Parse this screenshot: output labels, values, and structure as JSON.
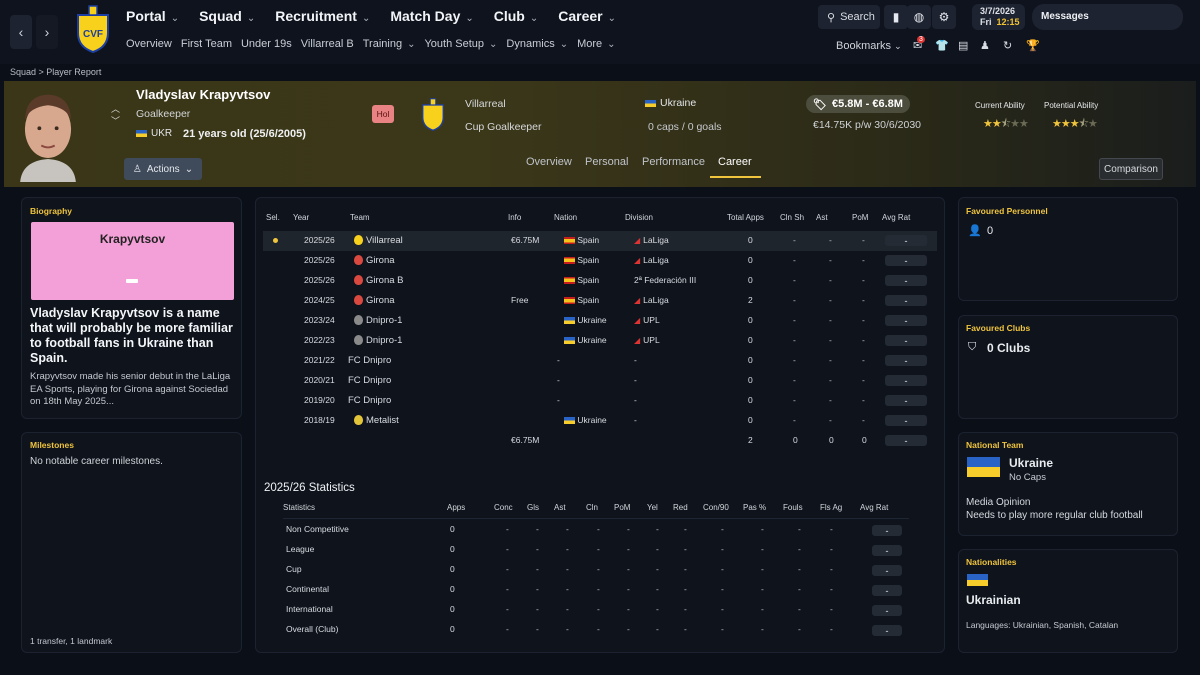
{
  "nav": {
    "main": [
      "Portal",
      "Squad",
      "Recruitment",
      "Match Day",
      "Club",
      "Career"
    ],
    "sub": [
      "Overview",
      "First Team",
      "Under 19s",
      "Villarreal B",
      "Training",
      "Youth Setup",
      "Dynamics",
      "More"
    ],
    "search_label": "Search",
    "date": "3/7/2026",
    "day": "Fri",
    "time": "12:15",
    "messages": "Messages",
    "bookmarks": "Bookmarks",
    "notif_count": "3"
  },
  "breadcrumb": {
    "parent": "Squad",
    "current": "Player Report"
  },
  "player": {
    "name": "Vladyslav Krapyvtsov",
    "position": "Goalkeeper",
    "nation_code": "UKR",
    "age": "21 years old (25/6/2005)",
    "actions": "Actions",
    "hol": "Hol",
    "club": "Villarreal",
    "role": "Cup Goalkeeper",
    "national": "Ukraine",
    "caps": "0 caps / 0 goals",
    "value": "€5.8M - €6.8M",
    "wage": "€14.75K p/w 30/6/2030",
    "current_ability_label": "Current Ability",
    "potential_ability_label": "Potential Ability",
    "current_ability_stars": 2.5,
    "potential_ability_stars": 3.5
  },
  "tabs": [
    "Overview",
    "Personal",
    "Performance",
    "Career"
  ],
  "active_tab": "Career",
  "comparison": "Comparison",
  "biography": {
    "title": "Biography",
    "image_name": "Krapyvtsov",
    "lead": "Vladyslav Krapyvtsov is a name that will probably be more familiar to football fans in Ukraine than Spain.",
    "text": "Krapyvtsov made his senior debut in the LaLiga EA Sports, playing for Girona against Sociedad on 18th May 2025..."
  },
  "milestones": {
    "title": "Milestones",
    "text": "No notable career milestones.",
    "footer": "1 transfer, 1 landmark"
  },
  "career": {
    "headers": [
      "Sel.",
      "Year",
      "Team",
      "Info",
      "Nation",
      "Division",
      "Total Apps",
      "Cln Sh",
      "Ast",
      "PoM",
      "Avg Rat"
    ],
    "rows": [
      {
        "year": "2025/26",
        "team": "Villarreal",
        "info": "€6.75M",
        "nation": "Spain",
        "division": "LaLiga",
        "apps": "0",
        "cln": "-",
        "ast": "-",
        "pom": "-",
        "rat": "-",
        "selected": true
      },
      {
        "year": "2025/26",
        "team": "Girona",
        "info": "",
        "nation": "Spain",
        "division": "LaLiga",
        "apps": "0",
        "cln": "-",
        "ast": "-",
        "pom": "-",
        "rat": "-"
      },
      {
        "year": "2025/26",
        "team": "Girona B",
        "info": "",
        "nation": "Spain",
        "division": "2ª Federación III",
        "apps": "0",
        "cln": "-",
        "ast": "-",
        "pom": "-",
        "rat": "-"
      },
      {
        "year": "2024/25",
        "team": "Girona",
        "info": "Free",
        "nation": "Spain",
        "division": "LaLiga",
        "apps": "2",
        "cln": "-",
        "ast": "-",
        "pom": "-",
        "rat": "-"
      },
      {
        "year": "2023/24",
        "team": "Dnipro-1",
        "info": "",
        "nation": "Ukraine",
        "division": "UPL",
        "apps": "0",
        "cln": "-",
        "ast": "-",
        "pom": "-",
        "rat": "-"
      },
      {
        "year": "2022/23",
        "team": "Dnipro-1",
        "info": "",
        "nation": "Ukraine",
        "division": "UPL",
        "apps": "0",
        "cln": "-",
        "ast": "-",
        "pom": "-",
        "rat": "-"
      },
      {
        "year": "2021/22",
        "team": "FC Dnipro",
        "info": "",
        "nation": "-",
        "division": "-",
        "apps": "0",
        "cln": "-",
        "ast": "-",
        "pom": "-",
        "rat": "-"
      },
      {
        "year": "2020/21",
        "team": "FC Dnipro",
        "info": "",
        "nation": "-",
        "division": "-",
        "apps": "0",
        "cln": "-",
        "ast": "-",
        "pom": "-",
        "rat": "-"
      },
      {
        "year": "2019/20",
        "team": "FC Dnipro",
        "info": "",
        "nation": "-",
        "division": "-",
        "apps": "0",
        "cln": "-",
        "ast": "-",
        "pom": "-",
        "rat": "-"
      },
      {
        "year": "2018/19",
        "team": "Metalist",
        "info": "",
        "nation": "Ukraine",
        "division": "-",
        "apps": "0",
        "cln": "-",
        "ast": "-",
        "pom": "-",
        "rat": "-"
      }
    ],
    "totals": {
      "info": "€6.75M",
      "apps": "2",
      "cln": "0",
      "ast": "0",
      "pom": "0",
      "rat": "-"
    }
  },
  "statistics": {
    "title": "2025/26 Statistics",
    "headers": [
      "Statistics",
      "Apps",
      "Conc",
      "Gls",
      "Ast",
      "Cln",
      "PoM",
      "Yel",
      "Red",
      "Con/90",
      "Pas %",
      "Fouls",
      "Fls Ag",
      "Avg Rat"
    ],
    "rows": [
      {
        "name": "Non Competitive",
        "apps": "0"
      },
      {
        "name": "League",
        "apps": "0"
      },
      {
        "name": "Cup",
        "apps": "0"
      },
      {
        "name": "Continental",
        "apps": "0"
      },
      {
        "name": "International",
        "apps": "0"
      },
      {
        "name": "Overall (Club)",
        "apps": "0"
      }
    ]
  },
  "favoured_personnel": {
    "title": "Favoured Personnel",
    "count": "0"
  },
  "favoured_clubs": {
    "title": "Favoured Clubs",
    "text": "0 Clubs"
  },
  "national_team": {
    "title": "National Team",
    "country": "Ukraine",
    "caps": "No Caps",
    "media_label": "Media Opinion",
    "media_text": "Needs to play more regular club football"
  },
  "nationalities": {
    "title": "Nationalities",
    "name": "Ukrainian",
    "languages": "Languages: Ukrainian, Spanish, Catalan"
  },
  "colors": {
    "accent": "#f0c43c",
    "background": "#0b0f17",
    "panel": "#0e131c",
    "header": "#3a3617"
  }
}
